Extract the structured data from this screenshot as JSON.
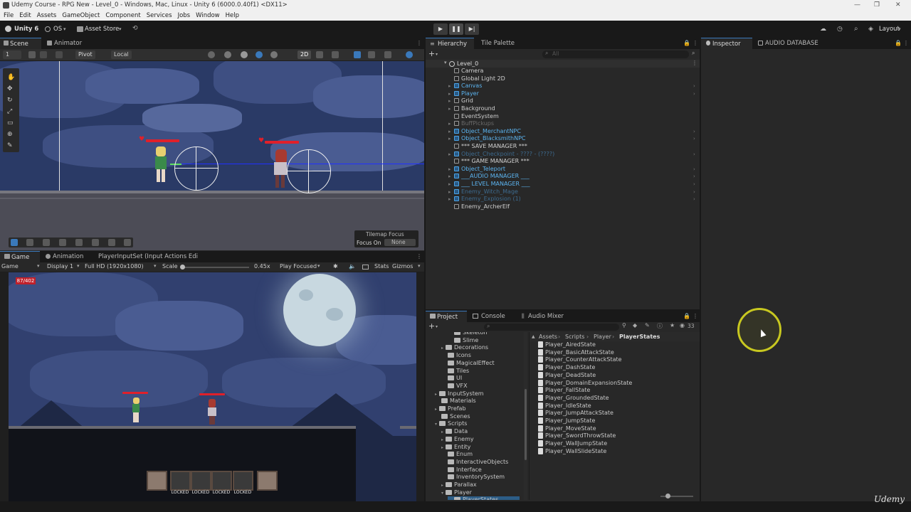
{
  "window": {
    "title": "Udemy Course - RPG New - Level_0 - Windows, Mac, Linux - Unity 6 (6000.0.40f1) <DX11>",
    "controls": [
      "—",
      "❐",
      "✕"
    ]
  },
  "menu": [
    "File",
    "Edit",
    "Assets",
    "GameObject",
    "Component",
    "Services",
    "Jobs",
    "Window",
    "Help"
  ],
  "toolbar": {
    "account": "Unity 6",
    "os": "OS",
    "asset_store": "Asset Store",
    "layout": "Layout"
  },
  "scene_panel": {
    "tabs": [
      "Scene",
      "Animator"
    ],
    "layer_count": "1",
    "pivot": "Pivot",
    "local": "Local",
    "mode_2d": "2D",
    "overlay": {
      "title": "Tilemap Focus",
      "label": "Focus On",
      "value": "None"
    }
  },
  "game_panel": {
    "tabs": [
      "Game",
      "Animation",
      "PlayerInputSet (Input Actions Edi"
    ],
    "mode": "Game",
    "display": "Display 1",
    "resolution": "Full HD (1920x1080)",
    "scale_label": "Scale",
    "scale_value": "0.45x",
    "play_focused": "Play Focused",
    "stats": "Stats",
    "gizmos": "Gizmos",
    "hp": "87/402",
    "skill_slots": [
      "LOCKED",
      "LOCKED",
      "LOCKED",
      "LOCKED"
    ]
  },
  "hierarchy": {
    "tabs": [
      "Hierarchy",
      "Tile Palette"
    ],
    "search_placeholder": "All",
    "scene": "Level_0",
    "items": [
      {
        "name": "Camera",
        "prefab": false,
        "dim": false
      },
      {
        "name": "Global Light 2D",
        "prefab": false,
        "dim": false
      },
      {
        "name": "Canvas",
        "prefab": true,
        "dim": false
      },
      {
        "name": "Player",
        "prefab": true,
        "dim": false
      },
      {
        "name": "Grid",
        "prefab": false,
        "dim": false
      },
      {
        "name": "Background",
        "prefab": false,
        "dim": false
      },
      {
        "name": "EventSystem",
        "prefab": false,
        "dim": false
      },
      {
        "name": "BuffPickups",
        "prefab": false,
        "dim": true
      },
      {
        "name": "Object_MerchantNPC",
        "prefab": true,
        "dim": false
      },
      {
        "name": "Object_BlacksmithNPC",
        "prefab": true,
        "dim": false
      },
      {
        "name": "*** SAVE MANAGER ***",
        "prefab": false,
        "dim": false
      },
      {
        "name": "Object_Checkpoint - ???? - (????)",
        "prefab": true,
        "dim": true
      },
      {
        "name": "*** GAME MANAGER ***",
        "prefab": false,
        "dim": false
      },
      {
        "name": "Object_Teleport",
        "prefab": true,
        "dim": false
      },
      {
        "name": "___AUDIO MANAGER ___",
        "prefab": true,
        "dim": false
      },
      {
        "name": "___ LEVEL MANAGER ___",
        "prefab": true,
        "dim": false
      },
      {
        "name": "Enemy_Witch_Mage",
        "prefab": true,
        "dim": true
      },
      {
        "name": "Enemy_Explosion (1)",
        "prefab": true,
        "dim": true
      },
      {
        "name": "Enemy_ArcherElf",
        "prefab": false,
        "dim": false
      }
    ]
  },
  "inspector": {
    "tabs": [
      "Inspector",
      "AUDIO DATABASE"
    ]
  },
  "project": {
    "tabs": [
      "Project",
      "Console",
      "Audio Mixer"
    ],
    "count": "33",
    "breadcrumb": [
      "Assets",
      "Scripts",
      "Player",
      "PlayerStates"
    ],
    "tree": [
      {
        "name": "Skeleton",
        "indent": 3
      },
      {
        "name": "Slime",
        "indent": 3
      },
      {
        "name": "Decorations",
        "indent": 2
      },
      {
        "name": "Icons",
        "indent": 2
      },
      {
        "name": "MagicalEffect",
        "indent": 2
      },
      {
        "name": "Tiles",
        "indent": 2
      },
      {
        "name": "UI",
        "indent": 2
      },
      {
        "name": "VFX",
        "indent": 2
      },
      {
        "name": "InputSystem",
        "indent": 1
      },
      {
        "name": "Materials",
        "indent": 1
      },
      {
        "name": "Prefab",
        "indent": 1
      },
      {
        "name": "Scenes",
        "indent": 1
      },
      {
        "name": "Scripts",
        "indent": 1
      },
      {
        "name": "Data",
        "indent": 2
      },
      {
        "name": "Enemy",
        "indent": 2
      },
      {
        "name": "Entity",
        "indent": 2
      },
      {
        "name": "Enum",
        "indent": 2
      },
      {
        "name": "InteractiveObjects",
        "indent": 2
      },
      {
        "name": "Interface",
        "indent": 2
      },
      {
        "name": "InventorySystem",
        "indent": 2
      },
      {
        "name": "Parallax",
        "indent": 2
      },
      {
        "name": "Player",
        "indent": 2
      },
      {
        "name": "PlayerStates",
        "indent": 3
      }
    ],
    "files": [
      "Player_AiredState",
      "Player_BasicAttackState",
      "Player_CounterAttackState",
      "Player_DashState",
      "Player_DeadState",
      "Player_DomainExpansionState",
      "Player_FallState",
      "Player_GroundedState",
      "Player_IdleState",
      "Player_JumpAttackState",
      "Player_JumpState",
      "Player_MoveState",
      "Player_SwordThrowState",
      "Player_WallJumpState",
      "Player_WallSlideState"
    ]
  },
  "watermark": "Udemy",
  "colors": {
    "accent": "#3a79bb",
    "prefab": "#5cb4f0",
    "hp": "#e0202a",
    "cursor_ring": "#c8c820"
  }
}
